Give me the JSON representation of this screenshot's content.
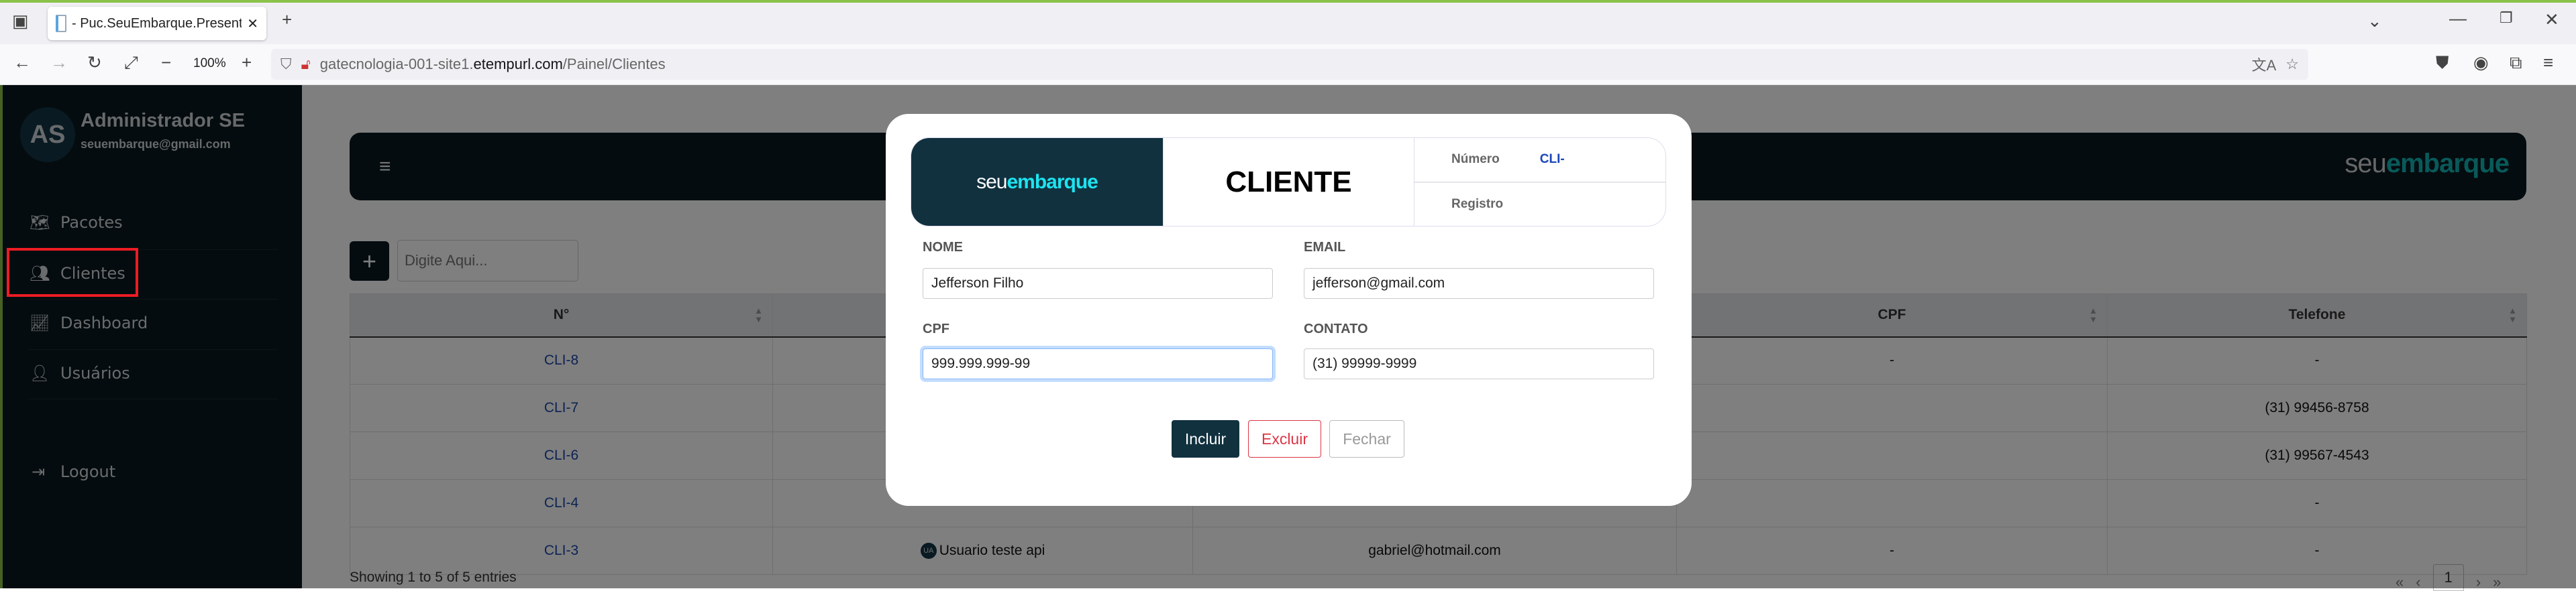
{
  "browser": {
    "tab_title": "- Puc.SeuEmbarque.Presentation",
    "zoom": "100%",
    "url_host_prefix": "gatecnologia-001-site1.",
    "url_host": "etempurl.com",
    "url_path": "/Painel/Clientes"
  },
  "sidebar": {
    "avatar_initials": "AS",
    "user_name": "Administrador SE",
    "user_email": "seuembarque@gmail.com",
    "items": [
      {
        "label": "Pacotes",
        "icon": "map-icon"
      },
      {
        "label": "Clientes",
        "icon": "users-icon"
      },
      {
        "label": "Dashboard",
        "icon": "chart-line-icon"
      },
      {
        "label": "Usuários",
        "icon": "user-icon"
      }
    ],
    "logout": "Logout"
  },
  "header": {
    "logo_a": "seu",
    "logo_b": "embarque"
  },
  "toolbar": {
    "search_placeholder": "Digite Aqui..."
  },
  "table": {
    "columns": [
      "N°",
      "",
      "",
      "CPF",
      "Telefone"
    ],
    "rows": [
      {
        "num": "CLI-8",
        "nome": "",
        "email": "",
        "cpf": "-",
        "tel": "-"
      },
      {
        "num": "CLI-7",
        "nome": "",
        "email": "",
        "cpf": "",
        "tel": "(31) 99456-8758"
      },
      {
        "num": "CLI-6",
        "nome": "",
        "email": "",
        "cpf": "",
        "tel": "(31) 99567-4543"
      },
      {
        "num": "CLI-4",
        "nome": "",
        "email": "",
        "cpf": "",
        "tel": "-"
      },
      {
        "num": "CLI-3",
        "avatar": "UA",
        "nome": "Usuario teste api",
        "email": "gabriel@hotmail.com",
        "cpf": "-",
        "tel": "-"
      }
    ],
    "showing": "Showing 1 to 5 of 5 entries",
    "pager": {
      "first": "«",
      "prev": "‹",
      "current": "1",
      "next": "›",
      "last": "»"
    }
  },
  "modal": {
    "logo_a": "seu",
    "logo_b": "embarque",
    "title": "CLIENTE",
    "numero_label": "Número",
    "numero_value": "CLI-",
    "registro_label": "Registro",
    "nome_label": "NOME",
    "nome_value": "Jefferson Filho",
    "email_label": "EMAIL",
    "email_value": "jefferson@gmail.com",
    "cpf_label": "CPF",
    "cpf_value": "999.999.999-99",
    "contato_label": "CONTATO",
    "contato_value": "(31) 99999-9999",
    "incluir": "Incluir",
    "excluir": "Excluir",
    "fechar": "Fechar"
  },
  "colors": {
    "sidebar": "#08181f",
    "accent": "#12b5b5",
    "danger": "#dc3545",
    "annotation": "#ed1c24"
  }
}
